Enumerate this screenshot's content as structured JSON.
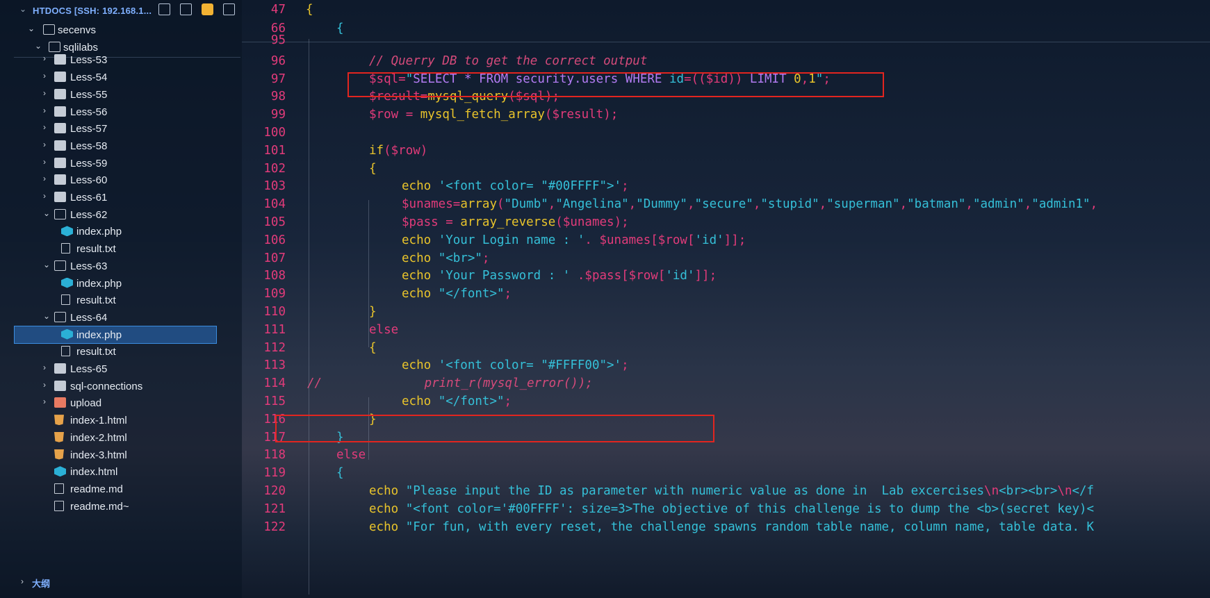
{
  "explorer": {
    "title": "HTDOCS [SSH: 192.168.1...",
    "actions": [
      "new-file-icon",
      "new-folder-icon",
      "beer-icon",
      "collapse-all-icon"
    ],
    "items": [
      {
        "label": "secenvs",
        "type": "folder-open",
        "level": 1
      },
      {
        "label": "sqlilabs",
        "type": "folder-open",
        "level": 2
      },
      {
        "label": "Less-53",
        "type": "folder",
        "level": 3
      },
      {
        "label": "Less-54",
        "type": "folder",
        "level": 3
      },
      {
        "label": "Less-55",
        "type": "folder",
        "level": 3
      },
      {
        "label": "Less-56",
        "type": "folder",
        "level": 3
      },
      {
        "label": "Less-57",
        "type": "folder",
        "level": 3
      },
      {
        "label": "Less-58",
        "type": "folder",
        "level": 3
      },
      {
        "label": "Less-59",
        "type": "folder",
        "level": 3
      },
      {
        "label": "Less-60",
        "type": "folder",
        "level": 3
      },
      {
        "label": "Less-61",
        "type": "folder",
        "level": 3
      },
      {
        "label": "Less-62",
        "type": "folder-open",
        "level": 3
      },
      {
        "label": "index.php",
        "type": "php",
        "level": 4
      },
      {
        "label": "result.txt",
        "type": "txt",
        "level": 4
      },
      {
        "label": "Less-63",
        "type": "folder-open",
        "level": 3
      },
      {
        "label": "index.php",
        "type": "php",
        "level": 4
      },
      {
        "label": "result.txt",
        "type": "txt",
        "level": 4
      },
      {
        "label": "Less-64",
        "type": "folder-open",
        "level": 3
      },
      {
        "label": "index.php",
        "type": "php",
        "level": 4,
        "selected": true
      },
      {
        "label": "result.txt",
        "type": "txt",
        "level": 4
      },
      {
        "label": "Less-65",
        "type": "folder",
        "level": 3
      },
      {
        "label": "sql-connections",
        "type": "folder",
        "level": 3
      },
      {
        "label": "upload",
        "type": "upload",
        "level": 3
      },
      {
        "label": "index-1.html",
        "type": "html5",
        "level": 3
      },
      {
        "label": "index-2.html",
        "type": "html5",
        "level": 3
      },
      {
        "label": "index-3.html",
        "type": "html5",
        "level": 3
      },
      {
        "label": "index.html",
        "type": "php",
        "level": 3
      },
      {
        "label": "readme.md",
        "type": "md",
        "level": 3
      },
      {
        "label": "readme.md~",
        "type": "md",
        "level": 3
      }
    ],
    "outline_label": "大纲"
  },
  "editor": {
    "sticky": [
      {
        "line": "47",
        "text": "{"
      },
      {
        "line": "66",
        "text": "{"
      }
    ],
    "lines": [
      {
        "n": "95",
        "tokens": []
      },
      {
        "n": "96",
        "tokens": [
          [
            "cm",
            "// Querry DB to get the correct output"
          ]
        ]
      },
      {
        "n": "97",
        "tokens": [
          [
            "var",
            "$sql"
          ],
          [
            "punct",
            "="
          ],
          [
            "str",
            "\""
          ],
          [
            "sql",
            "SELECT * FROM security.users WHERE "
          ],
          [
            "str",
            "id"
          ],
          [
            "punct",
            "=(("
          ],
          [
            "var",
            "$id"
          ],
          [
            "punct",
            "))"
          ],
          [
            "sql",
            " LIMIT "
          ],
          [
            "num",
            "0"
          ],
          [
            "punct",
            ","
          ],
          [
            "num",
            "1"
          ],
          [
            "str",
            "\""
          ],
          [
            "punct",
            ";"
          ]
        ]
      },
      {
        "n": "98",
        "tokens": [
          [
            "var",
            "$result"
          ],
          [
            "punct",
            "="
          ],
          [
            "fn",
            "mysql_query"
          ],
          [
            "punct",
            "("
          ],
          [
            "var",
            "$sql"
          ],
          [
            "punct",
            ");"
          ]
        ]
      },
      {
        "n": "99",
        "tokens": [
          [
            "var",
            "$row"
          ],
          [
            "punct",
            " = "
          ],
          [
            "fn",
            "mysql_fetch_array"
          ],
          [
            "punct",
            "("
          ],
          [
            "var",
            "$result"
          ],
          [
            "punct",
            ");"
          ]
        ]
      },
      {
        "n": "100",
        "tokens": []
      },
      {
        "n": "101",
        "tokens": [
          [
            "kw",
            "if"
          ],
          [
            "punct",
            "("
          ],
          [
            "var",
            "$row"
          ],
          [
            "punct",
            ")"
          ]
        ]
      },
      {
        "n": "102",
        "tokens": [
          [
            "kw",
            "{"
          ]
        ]
      },
      {
        "n": "103",
        "tokens": [
          [
            "kw",
            "echo "
          ],
          [
            "str",
            "'<font color= \"#00FFFF\">'"
          ],
          [
            "punct",
            ";"
          ]
        ]
      },
      {
        "n": "104",
        "tokens": [
          [
            "var",
            "$unames"
          ],
          [
            "punct",
            "="
          ],
          [
            "fn",
            "array"
          ],
          [
            "punct",
            "("
          ],
          [
            "str",
            "\"Dumb\""
          ],
          [
            "punct",
            ","
          ],
          [
            "str",
            "\"Angelina\""
          ],
          [
            "punct",
            ","
          ],
          [
            "str",
            "\"Dummy\""
          ],
          [
            "punct",
            ","
          ],
          [
            "str",
            "\"secure\""
          ],
          [
            "punct",
            ","
          ],
          [
            "str",
            "\"stupid\""
          ],
          [
            "punct",
            ","
          ],
          [
            "str",
            "\"superman\""
          ],
          [
            "punct",
            ","
          ],
          [
            "str",
            "\"batman\""
          ],
          [
            "punct",
            ","
          ],
          [
            "str",
            "\"admin\""
          ],
          [
            "punct",
            ","
          ],
          [
            "str",
            "\"admin1\""
          ],
          [
            "punct",
            ","
          ]
        ]
      },
      {
        "n": "105",
        "tokens": [
          [
            "var",
            "$pass"
          ],
          [
            "punct",
            " = "
          ],
          [
            "fn",
            "array_reverse"
          ],
          [
            "punct",
            "("
          ],
          [
            "var",
            "$unames"
          ],
          [
            "punct",
            ");"
          ]
        ]
      },
      {
        "n": "106",
        "tokens": [
          [
            "kw",
            "echo "
          ],
          [
            "str",
            "'Your Login name : '"
          ],
          [
            "punct",
            ". "
          ],
          [
            "var",
            "$unames"
          ],
          [
            "punct",
            "["
          ],
          [
            "var",
            "$row"
          ],
          [
            "punct",
            "["
          ],
          [
            "str",
            "'id'"
          ],
          [
            "punct",
            "]];"
          ]
        ]
      },
      {
        "n": "107",
        "tokens": [
          [
            "kw",
            "echo "
          ],
          [
            "str",
            "\"<br>\""
          ],
          [
            "punct",
            ";"
          ]
        ]
      },
      {
        "n": "108",
        "tokens": [
          [
            "kw",
            "echo "
          ],
          [
            "str",
            "'Your Password : '"
          ],
          [
            "punct",
            " ."
          ],
          [
            "var",
            "$pass"
          ],
          [
            "punct",
            "["
          ],
          [
            "var",
            "$row"
          ],
          [
            "punct",
            "["
          ],
          [
            "str",
            "'id'"
          ],
          [
            "punct",
            "]];"
          ]
        ]
      },
      {
        "n": "109",
        "tokens": [
          [
            "kw",
            "echo "
          ],
          [
            "str",
            "\"</font>\""
          ],
          [
            "punct",
            ";"
          ]
        ]
      },
      {
        "n": "110",
        "tokens": [
          [
            "kw",
            "}"
          ]
        ]
      },
      {
        "n": "111",
        "tokens": [
          [
            "var",
            "else"
          ]
        ]
      },
      {
        "n": "112",
        "tokens": [
          [
            "kw",
            "{"
          ]
        ]
      },
      {
        "n": "113",
        "tokens": [
          [
            "kw",
            "echo "
          ],
          [
            "str",
            "'<font color= \"#FFFF00\">'"
          ],
          [
            "punct",
            ";"
          ]
        ]
      },
      {
        "n": "114",
        "tokens": [
          [
            "cm",
            "//              print_r(mysql_error());"
          ]
        ]
      },
      {
        "n": "115",
        "tokens": [
          [
            "kw",
            "echo "
          ],
          [
            "str",
            "\"</font>\""
          ],
          [
            "punct",
            ";"
          ]
        ]
      },
      {
        "n": "116",
        "tokens": [
          [
            "kw",
            "}"
          ]
        ]
      },
      {
        "n": "117",
        "tokens": [
          [
            "str",
            "}"
          ]
        ]
      },
      {
        "n": "118",
        "tokens": [
          [
            "var",
            "else"
          ]
        ]
      },
      {
        "n": "119",
        "tokens": [
          [
            "str",
            "{"
          ]
        ]
      },
      {
        "n": "120",
        "tokens": [
          [
            "kw",
            "echo "
          ],
          [
            "str",
            "\"Please input the ID as parameter with numeric value as done in  Lab excercises"
          ],
          [
            "var",
            "\\n"
          ],
          [
            "str",
            "<br><br>"
          ],
          [
            "var",
            "\\n"
          ],
          [
            "str",
            "</f"
          ]
        ]
      },
      {
        "n": "121",
        "tokens": [
          [
            "kw",
            "echo "
          ],
          [
            "str",
            "\"<font color='#00FFFF': size=3>The objective of this challenge is to dump the <b>(secret key)<"
          ]
        ]
      },
      {
        "n": "122",
        "tokens": [
          [
            "kw",
            "echo "
          ],
          [
            "str",
            "\"For fun, with every reset, the challenge spawns random table name, column name, table data. K"
          ]
        ]
      }
    ],
    "highlight_boxes": [
      "sql-query-highlight",
      "commented-error-highlight"
    ]
  }
}
